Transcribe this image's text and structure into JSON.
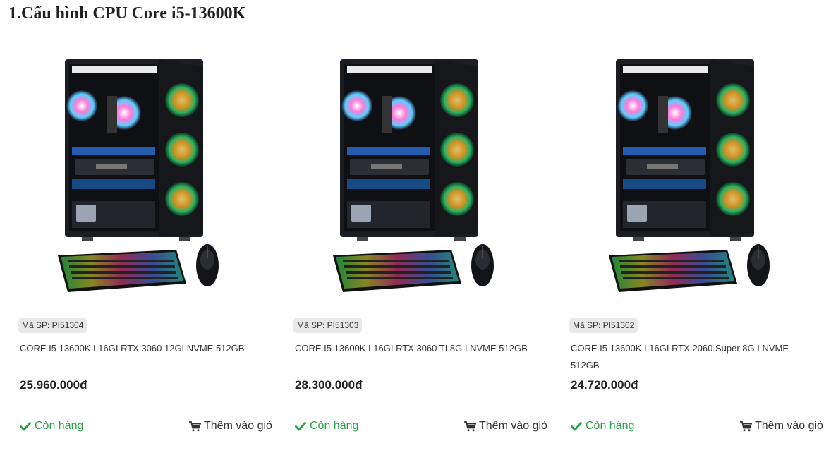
{
  "section": {
    "title": "1.Cấu hình CPU Core i5-13600K"
  },
  "products": [
    {
      "sku": "Mã SP: PI51304",
      "name": "CORE I5 13600K I 16GI RTX 3060 12GI NVME 512GB",
      "price": "25.960.000đ",
      "stock": "Còn hàng",
      "cart": "Thêm vào giỏ"
    },
    {
      "sku": "Mã SP: PI51303",
      "name": "CORE I5 13600K I 16GI RTX 3060 TI 8G I NVME 512GB",
      "price": "28.300.000đ",
      "stock": "Còn hàng",
      "cart": "Thêm vào giỏ"
    },
    {
      "sku": "Mã SP: PI51302",
      "name": "CORE I5 13600K I 16GI RTX 2060 Super 8G I NVME 512GB",
      "price": "24.720.000đ",
      "stock": "Còn hàng",
      "cart": "Thêm vào giỏ"
    }
  ],
  "icons": {
    "stock": "check-icon",
    "cart": "cart-icon",
    "product": "pc-case-keyboard-mouse-image"
  },
  "colors": {
    "in_stock": "#2aa34a",
    "sku_bg": "#e9e9e9",
    "text": "#333333"
  }
}
